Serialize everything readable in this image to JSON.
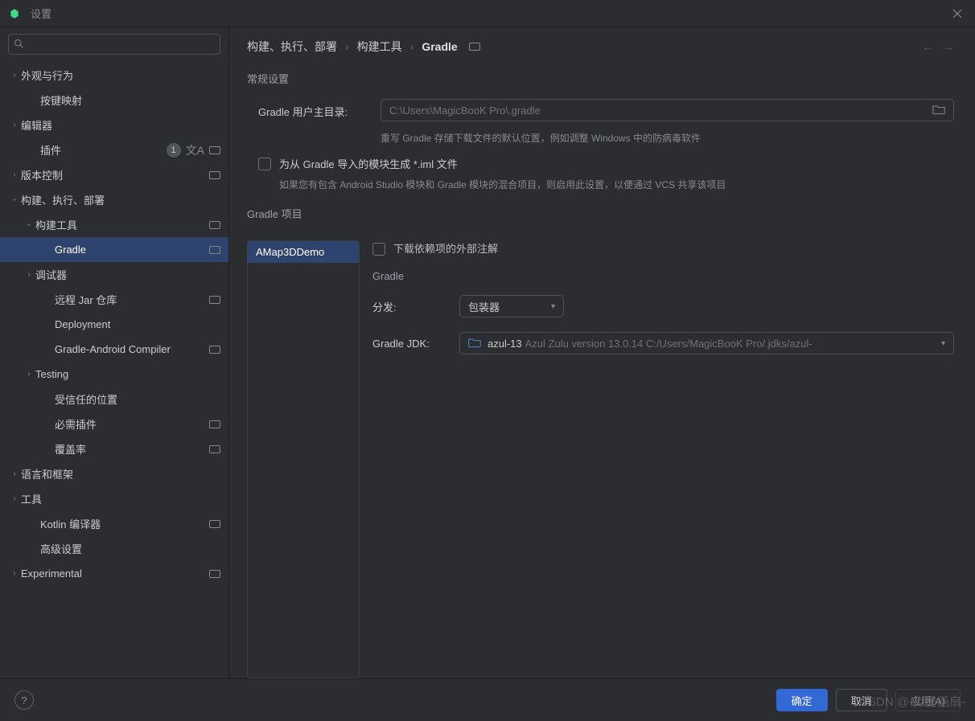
{
  "window": {
    "title": "设置"
  },
  "sidebar": {
    "search_placeholder": "",
    "items": [
      {
        "label": "外观与行为",
        "level": 0,
        "chev": "right"
      },
      {
        "label": "按键映射",
        "level": 1,
        "no_chev": true
      },
      {
        "label": "编辑器",
        "level": 0,
        "chev": "right"
      },
      {
        "label": "插件",
        "level": 1,
        "no_chev": true,
        "badge": "1",
        "lang": true,
        "proj": true
      },
      {
        "label": "版本控制",
        "level": 0,
        "chev": "right",
        "proj": true
      },
      {
        "label": "构建、执行、部署",
        "level": 0,
        "chev": "down"
      },
      {
        "label": "构建工具",
        "level": 1,
        "chev": "down",
        "proj": true
      },
      {
        "label": "Gradle",
        "level": 2,
        "no_chev": true,
        "selected": true,
        "proj": true
      },
      {
        "label": "调试器",
        "level": 1,
        "chev": "right"
      },
      {
        "label": "远程 Jar 仓库",
        "level": 2,
        "no_chev": true,
        "proj": true
      },
      {
        "label": "Deployment",
        "level": 2,
        "no_chev": true
      },
      {
        "label": "Gradle-Android Compiler",
        "level": 2,
        "no_chev": true,
        "proj": true
      },
      {
        "label": "Testing",
        "level": 1,
        "chev": "right"
      },
      {
        "label": "受信任的位置",
        "level": 2,
        "no_chev": true
      },
      {
        "label": "必需插件",
        "level": 2,
        "no_chev": true,
        "proj": true
      },
      {
        "label": "覆盖率",
        "level": 2,
        "no_chev": true,
        "proj": true
      },
      {
        "label": "语言和框架",
        "level": 0,
        "chev": "right"
      },
      {
        "label": "工具",
        "level": 0,
        "chev": "right"
      },
      {
        "label": "Kotlin 编译器",
        "level": 1,
        "no_chev": true,
        "proj": true
      },
      {
        "label": "高级设置",
        "level": 1,
        "no_chev": true
      },
      {
        "label": "Experimental",
        "level": 0,
        "chev": "right",
        "proj": true
      }
    ]
  },
  "breadcrumb": {
    "a": "构建、执行、部署",
    "b": "构建工具",
    "c": "Gradle"
  },
  "sections": {
    "general": "常规设置",
    "gradle_home_label": "Gradle 用户主目录:",
    "gradle_home_value": "C:\\Users\\MagicBooK Pro\\.gradle",
    "gradle_home_hint": "重写 Gradle 存储下载文件的默认位置，例如调整 Windows 中的防病毒软件",
    "iml_label": "为从 Gradle 导入的模块生成 *.iml 文件",
    "iml_hint": "如果您有包含 Android Studio 模块和 Gradle 模块的混合项目，则启用此设置，以便通过 VCS 共享该项目",
    "projects_title": "Gradle 项目",
    "project_name": "AMap3DDemo",
    "download_annotations": "下载依赖项的外部注解",
    "gradle_sub": "Gradle",
    "distribution_label": "分发:",
    "distribution_value": "包装器",
    "jdk_label": "Gradle JDK:",
    "jdk_value": "azul-13",
    "jdk_detail": "Azul Zulu version 13.0.14 C:/Users/MagicBooK Pro/.jdks/azul-"
  },
  "footer": {
    "ok": "确定",
    "cancel": "取消",
    "apply": "应用(A)"
  },
  "watermark": "CSDN @-拟墨画扇-"
}
